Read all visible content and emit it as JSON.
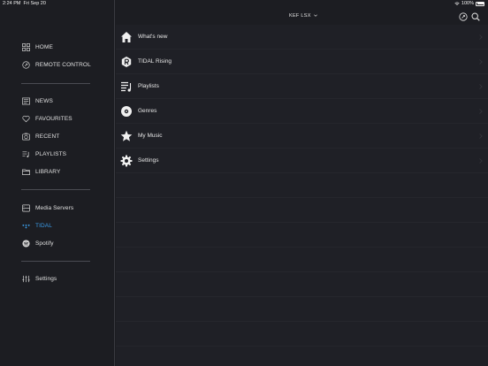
{
  "status_bar": {
    "time": "2:24 PM",
    "date": "Fri Sep 20",
    "battery": "100%",
    "battery_level": 1.0
  },
  "header": {
    "device_name": "KEF  LSX",
    "dropdown_icon": "chevron-down-icon",
    "remote_icon": "remote-control-icon",
    "search_icon": "search-icon"
  },
  "sidebar": {
    "items": [
      {
        "label": "HOME",
        "icon": "grid-icon"
      },
      {
        "label": "REMOTE CONTROL",
        "icon": "remote-control-icon"
      },
      {
        "label": "NEWS",
        "icon": "news-icon"
      },
      {
        "label": "FAVOURITES",
        "icon": "heart-icon"
      },
      {
        "label": "RECENT",
        "icon": "recent-icon"
      },
      {
        "label": "PLAYLISTS",
        "icon": "playlist-icon"
      },
      {
        "label": "LIBRARY",
        "icon": "folder-icon"
      },
      {
        "label": "Media Servers",
        "icon": "server-icon"
      },
      {
        "label": "TIDAL",
        "icon": "tidal-icon",
        "active": true
      },
      {
        "label": "Spotify",
        "icon": "spotify-icon"
      },
      {
        "label": "Settings",
        "icon": "sliders-icon"
      }
    ]
  },
  "main": {
    "items": [
      {
        "label": "What's new",
        "icon": "home-icon"
      },
      {
        "label": "TIDAL Rising",
        "icon": "rising-icon"
      },
      {
        "label": "Playlists",
        "icon": "playlist-icon"
      },
      {
        "label": "Genres",
        "icon": "vinyl-icon"
      },
      {
        "label": "My Music",
        "icon": "star-icon"
      },
      {
        "label": "Settings",
        "icon": "gear-icon"
      }
    ]
  },
  "colors": {
    "background": "#1c1d22",
    "content": "#1f2026",
    "accent": "#3b9ce8",
    "text": "#e6e6e6"
  }
}
